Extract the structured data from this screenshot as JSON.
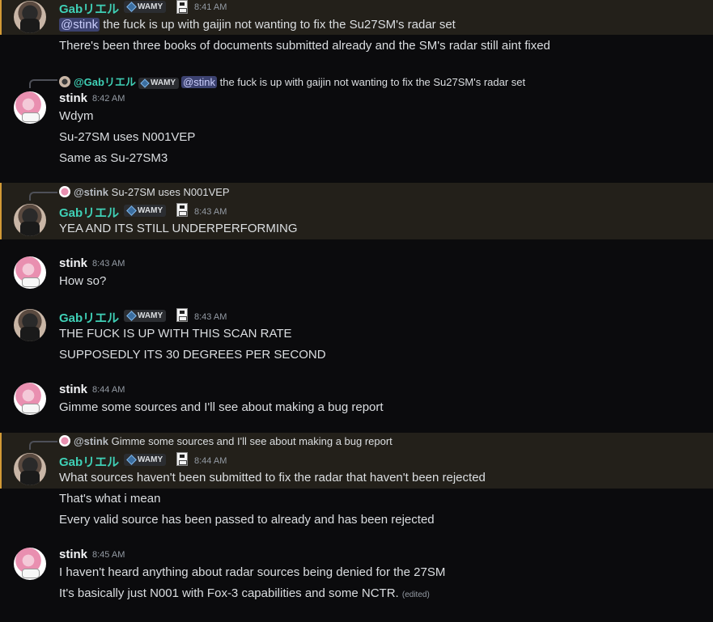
{
  "messages": [
    {
      "author": "Gabリエル",
      "tag": "WAMY",
      "time": "8:41 AM",
      "mention": "@stink",
      "line1": " the fuck is up with gaijin not wanting to fix the Su27SM's radar set",
      "line2": "There's been three books of documents submitted already and the SM's radar still aint fixed"
    },
    {
      "reply": {
        "name": "@Gabリエル",
        "tag": "WAMY",
        "mention": "@stink",
        "text": " the fuck is up with gaijin not wanting to fix the Su27SM's radar set"
      },
      "author": "stink",
      "time": "8:42 AM",
      "lines": [
        "Wdym",
        "Su-27SM uses N001VEP",
        "Same as Su-27SM3"
      ]
    },
    {
      "reply": {
        "name": "@stink",
        "text": " Su-27SM uses N001VEP"
      },
      "author": "Gabリエル",
      "tag": "WAMY",
      "time": "8:43 AM",
      "lines": [
        "YEA AND ITS STILL UNDERPERFORMING"
      ]
    },
    {
      "author": "stink",
      "time": "8:43 AM",
      "lines": [
        "How so?"
      ]
    },
    {
      "author": "Gabリエル",
      "tag": "WAMY",
      "time": "8:43 AM",
      "lines": [
        "THE FUCK IS UP WITH THIS SCAN RATE",
        "SUPPOSEDLY ITS 30 DEGREES PER SECOND"
      ]
    },
    {
      "author": "stink",
      "time": "8:44 AM",
      "lines": [
        "Gimme some sources and I'll see about making a bug report"
      ]
    },
    {
      "reply": {
        "name": "@stink",
        "text": " Gimme some sources and I'll see about making a bug report"
      },
      "author": "Gabリエル",
      "tag": "WAMY",
      "time": "8:44 AM",
      "lines": [
        "What sources haven't been submitted to fix the radar that haven't been rejected",
        "That's what i mean",
        "Every valid source has been passed to already and has been rejected"
      ]
    },
    {
      "author": "stink",
      "time": "8:45 AM",
      "lines": [
        "I haven't heard anything about radar sources being denied for the 27SM",
        "It's basically just N001 with Fox-3 capabilities and some NCTR."
      ],
      "edited": "(edited)"
    }
  ]
}
